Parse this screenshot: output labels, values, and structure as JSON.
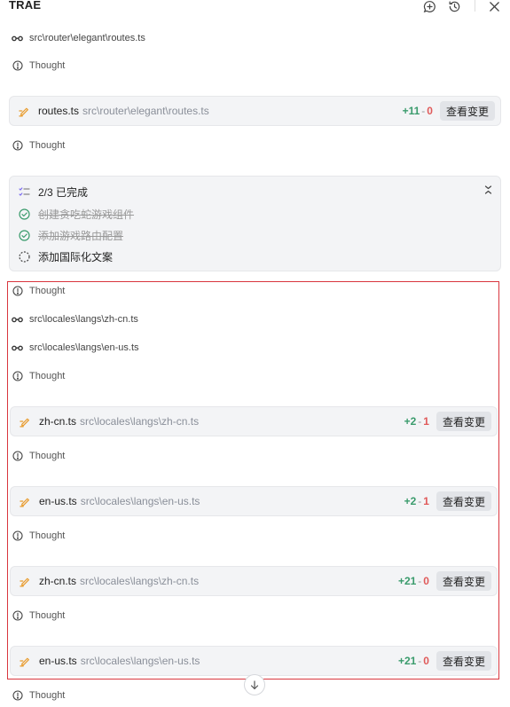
{
  "header": {
    "title": "TRAE"
  },
  "icons": {
    "new_chat": "chat-plus-icon",
    "history": "history-icon",
    "close": "close-icon",
    "read": "glasses-icon",
    "thought": "thought-icon",
    "edit": "pencil-edit-icon",
    "scroll_down": "arrow-down-icon"
  },
  "colors": {
    "added": "#3a9b6c",
    "removed": "#e05a5a",
    "highlight_border": "#d9363e"
  },
  "thought_label": "Thought",
  "view_changes_label": "查看变更",
  "reads": [
    "src\\router\\elegant\\routes.ts",
    "src\\locales\\langs\\zh-cn.ts",
    "src\\locales\\langs\\en-us.ts"
  ],
  "edits": [
    {
      "name": "routes.ts",
      "path": "src\\router\\elegant\\routes.ts",
      "added": "+11",
      "removed": "0"
    },
    {
      "name": "zh-cn.ts",
      "path": "src\\locales\\langs\\zh-cn.ts",
      "added": "+2",
      "removed": "1"
    },
    {
      "name": "en-us.ts",
      "path": "src\\locales\\langs\\en-us.ts",
      "added": "+2",
      "removed": "1"
    },
    {
      "name": "zh-cn.ts",
      "path": "src\\locales\\langs\\zh-cn.ts",
      "added": "+21",
      "removed": "0"
    },
    {
      "name": "en-us.ts",
      "path": "src\\locales\\langs\\en-us.ts",
      "added": "+21",
      "removed": "0"
    }
  ],
  "todo": {
    "progress": "2/3 已完成",
    "items": [
      {
        "text": "创建贪吃蛇游戏组件",
        "status": "done"
      },
      {
        "text": "添加游戏路由配置",
        "status": "done"
      },
      {
        "text": "添加国际化文案",
        "status": "pending"
      }
    ]
  }
}
